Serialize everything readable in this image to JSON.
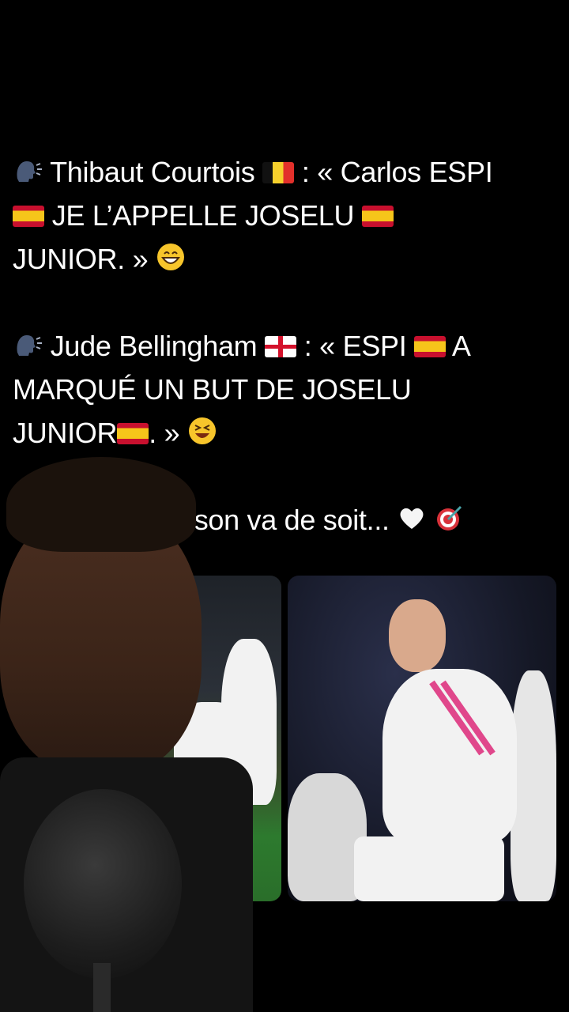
{
  "post": {
    "line1_name": "Thibaut Courtois",
    "line1_colon": ": « Carlos ESPI",
    "line2_text": "JE L’APPELLE JOSELU",
    "line3_text": "JUNIOR. »",
    "line4_name": "Jude Bellingham",
    "line4_colon": ": « ESPI",
    "line4_tail": "A",
    "line5_text": "MARQUÉ UN BUT DE JOSELU",
    "line6_text": "JUNIOR",
    "line6_tail": ". »",
    "line7_text": "ison va de soit..."
  },
  "icons": {
    "speak": "speaking-head-icon",
    "flag_be": "belgium-flag-icon",
    "flag_es": "spain-flag-icon",
    "flag_en": "england-flag-icon",
    "smile": "grinning-face-icon",
    "laugh": "laughing-face-icon",
    "heart": "white-heart-icon",
    "target": "direct-hit-icon"
  },
  "colors": {
    "background": "#000000",
    "text": "#ffffff"
  }
}
